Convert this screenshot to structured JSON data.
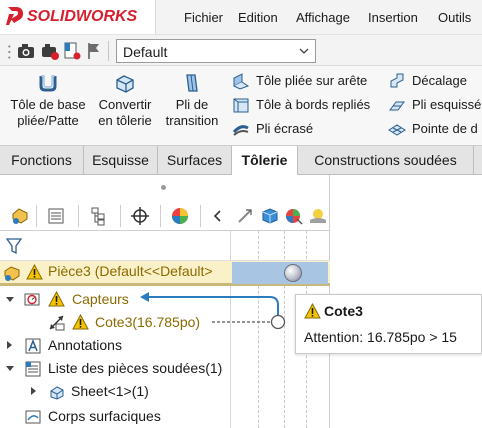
{
  "app": {
    "logo_text": "SOLIDWORKS",
    "brand_color": "#d5202e"
  },
  "menu": {
    "items": [
      "Fichier",
      "Edition",
      "Affichage",
      "Insertion",
      "Outils"
    ]
  },
  "quick_access": {
    "icons": [
      "camera-icon",
      "screenshot-record-icon",
      "bookmark-icon",
      "flag-icon",
      "settings-icon"
    ],
    "config_value": "Default"
  },
  "ribbon": {
    "big_commands": [
      {
        "label": "Tôle de base\npliée/Patte",
        "icon": "base-flange-icon"
      },
      {
        "label": "Convertir\nen tôlerie",
        "icon": "convert-to-sheet-metal-icon"
      },
      {
        "label": "Pli de\ntransition",
        "icon": "lofted-bend-icon"
      }
    ],
    "small_commands": [
      {
        "label": "Tôle pliée sur arête",
        "icon": "edge-flange-icon"
      },
      {
        "label": "Tôle à bords repliés",
        "icon": "miter-flange-icon"
      },
      {
        "label": "Pli écrasé",
        "icon": "hem-icon"
      },
      {
        "label": "Décalage",
        "icon": "jog-icon"
      },
      {
        "label": "Pli esquissé",
        "icon": "sketched-bend-icon"
      },
      {
        "label": "Pointe de d",
        "icon": "cross-break-icon"
      }
    ]
  },
  "tabs": [
    {
      "label": "Fonctions",
      "active": false
    },
    {
      "label": "Esquisse",
      "active": false
    },
    {
      "label": "Surfaces",
      "active": false
    },
    {
      "label": "Tôlerie",
      "active": true
    },
    {
      "label": "Constructions soudées",
      "active": false
    }
  ],
  "feature_tree": {
    "root": {
      "label": "Pièce3  (Default<<Default>",
      "warning": true
    },
    "items": [
      {
        "label": "Capteurs",
        "warning": true,
        "expander": "down"
      },
      {
        "label": "Cote3(16.785po)",
        "warning": true,
        "expander": "none"
      },
      {
        "label": "Annotations",
        "warning": false,
        "expander": "right"
      },
      {
        "label": "Liste des pièces soudées(1)",
        "warning": false,
        "expander": "down"
      },
      {
        "label": "Sheet<1>(1)",
        "warning": false,
        "expander": "right"
      },
      {
        "label": "Corps surfaciques",
        "warning": false,
        "expander": "none"
      }
    ]
  },
  "tooltip": {
    "title": "Cote3",
    "message": "Attention: 16.785po > 15"
  },
  "colors": {
    "warning_yellow": "#f5c400",
    "tree_highlight": "#fbf1c9",
    "selection_blue": "#a8c6e3",
    "link_blue": "#2b7bbf"
  }
}
